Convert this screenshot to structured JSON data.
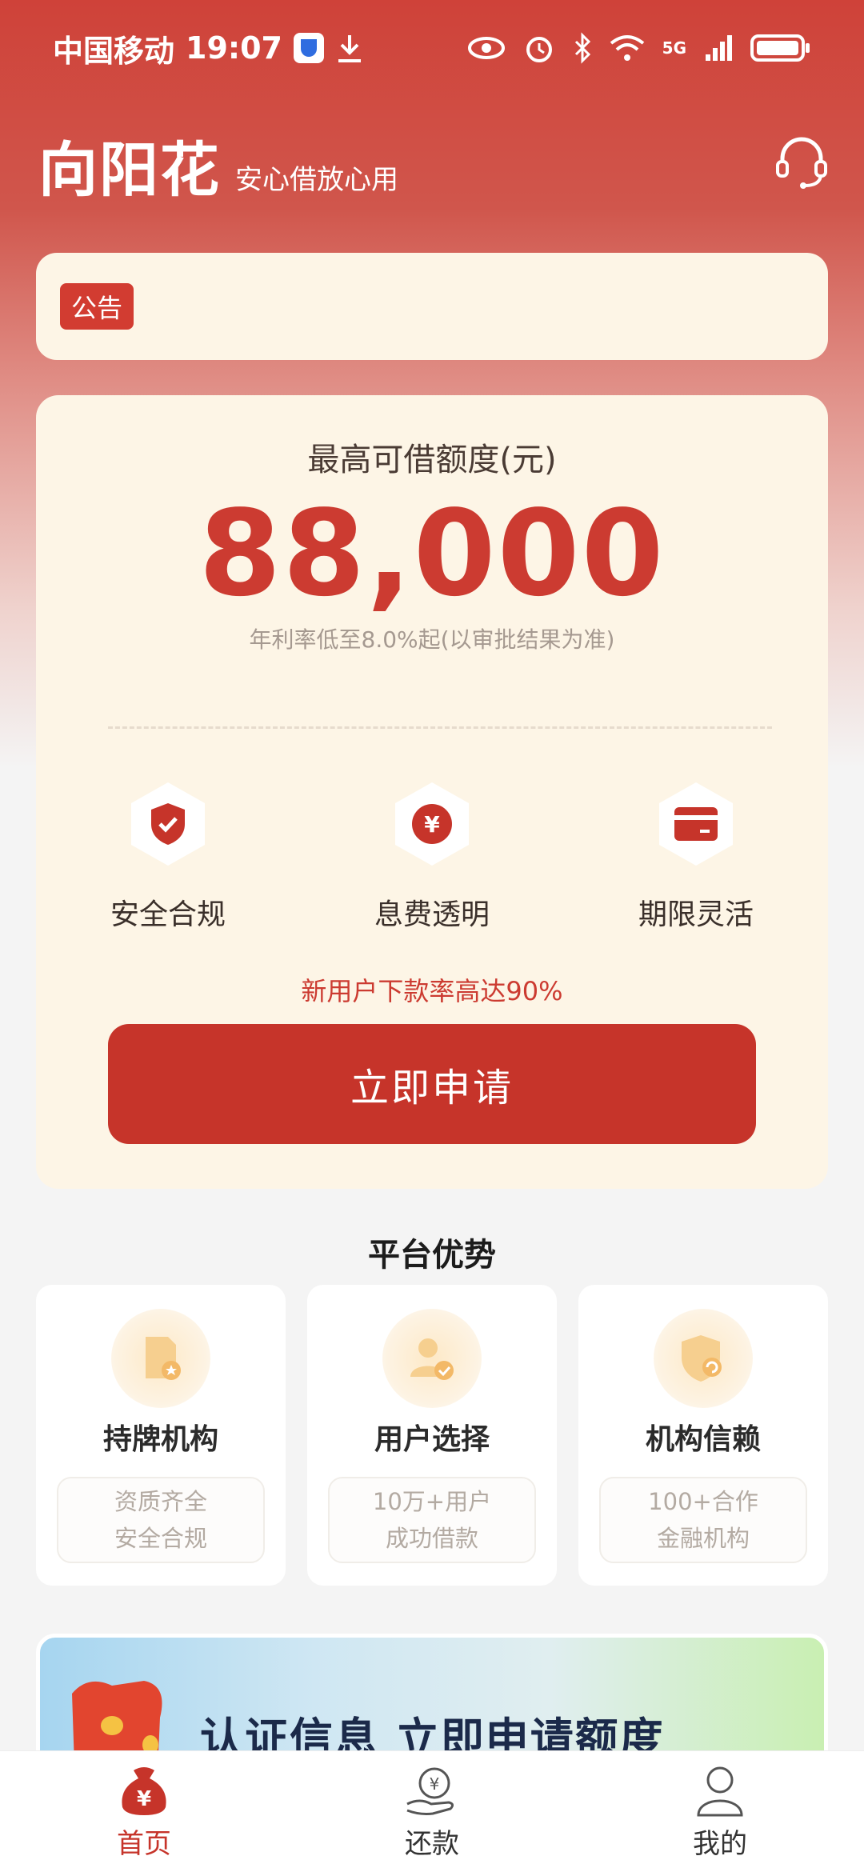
{
  "status_bar": {
    "carrier": "中国移动",
    "time": "19:07",
    "network": "5G"
  },
  "header": {
    "title": "向阳花",
    "slogan": "安心借放心用",
    "support_icon": "headset-icon"
  },
  "notice": {
    "tag": "公告",
    "text": ""
  },
  "credit": {
    "label": "最高可借额度(元)",
    "amount": "88,000",
    "rate_note": "年利率低至8.0%起(以审批结果为准)"
  },
  "features": [
    {
      "label": "安全合规",
      "icon": "shield-check-icon"
    },
    {
      "label": "息费透明",
      "icon": "yuan-coin-icon"
    },
    {
      "label": "期限灵活",
      "icon": "card-icon"
    }
  ],
  "promo": "新用户下款率高达90%",
  "apply_button": "立即申请",
  "advantages": {
    "title": "平台优势",
    "items": [
      {
        "name": "持牌机构",
        "desc_line1": "资质齐全",
        "desc_line2": "安全合规",
        "icon": "license-icon"
      },
      {
        "name": "用户选择",
        "desc_line1": "10万+用户",
        "desc_line2": "成功借款",
        "icon": "user-check-icon"
      },
      {
        "name": "机构信赖",
        "desc_line1": "100+合作",
        "desc_line2": "金融机构",
        "icon": "trust-shield-icon"
      }
    ]
  },
  "banner": {
    "text": "认证信息  立即申请额度"
  },
  "bottom_nav": [
    {
      "label": "首页",
      "icon": "money-bag-icon",
      "active": true
    },
    {
      "label": "还款",
      "icon": "repay-icon",
      "active": false
    },
    {
      "label": "我的",
      "icon": "profile-icon",
      "active": false
    }
  ],
  "colors": {
    "brand_red": "#c6342a",
    "card_cream": "#fdf5e6"
  }
}
